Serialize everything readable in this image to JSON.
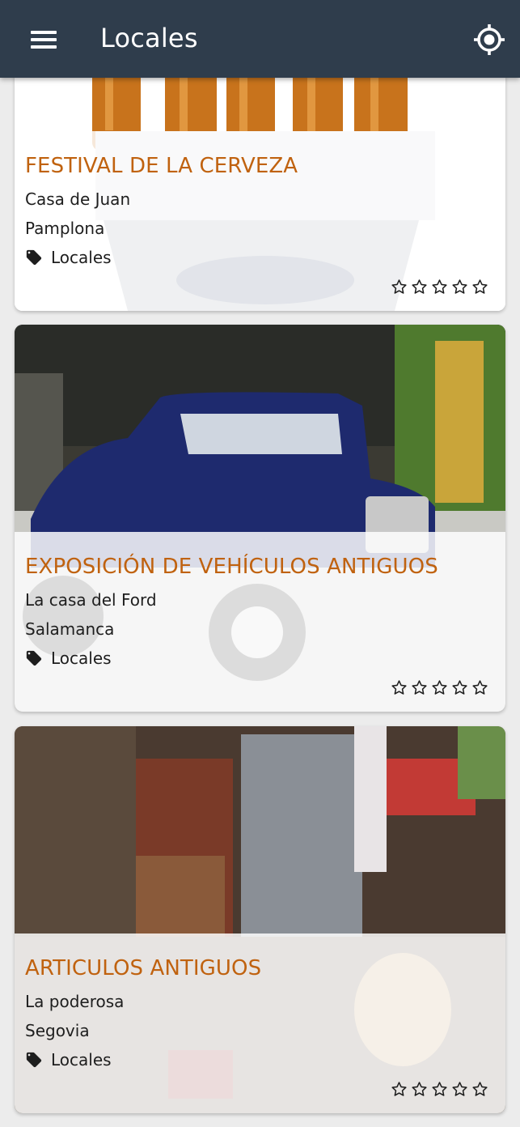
{
  "appbar": {
    "title": "Locales",
    "menu_icon": "hamburger-menu-icon",
    "locate_icon": "gps-locate-icon",
    "color": "#2f3d4c"
  },
  "accent_color": "#c0620f",
  "cards": [
    {
      "title": "FESTIVAL DE LA CERVEZA",
      "place": "Casa de Juan",
      "city": "Pamplona",
      "category": "Locales",
      "rating": 0,
      "image": "beer-bucket-photo"
    },
    {
      "title": "EXPOSICIÓN DE VEHÍCULOS ANTIGUOS",
      "place": "La casa del Ford",
      "city": "Salamanca",
      "category": "Locales",
      "rating": 0,
      "image": "vintage-car-photo"
    },
    {
      "title": "ARTICULOS ANTIGUOS",
      "place": "La poderosa",
      "city": "Segovia",
      "category": "Locales",
      "rating": 0,
      "image": "antique-shop-photo"
    }
  ]
}
